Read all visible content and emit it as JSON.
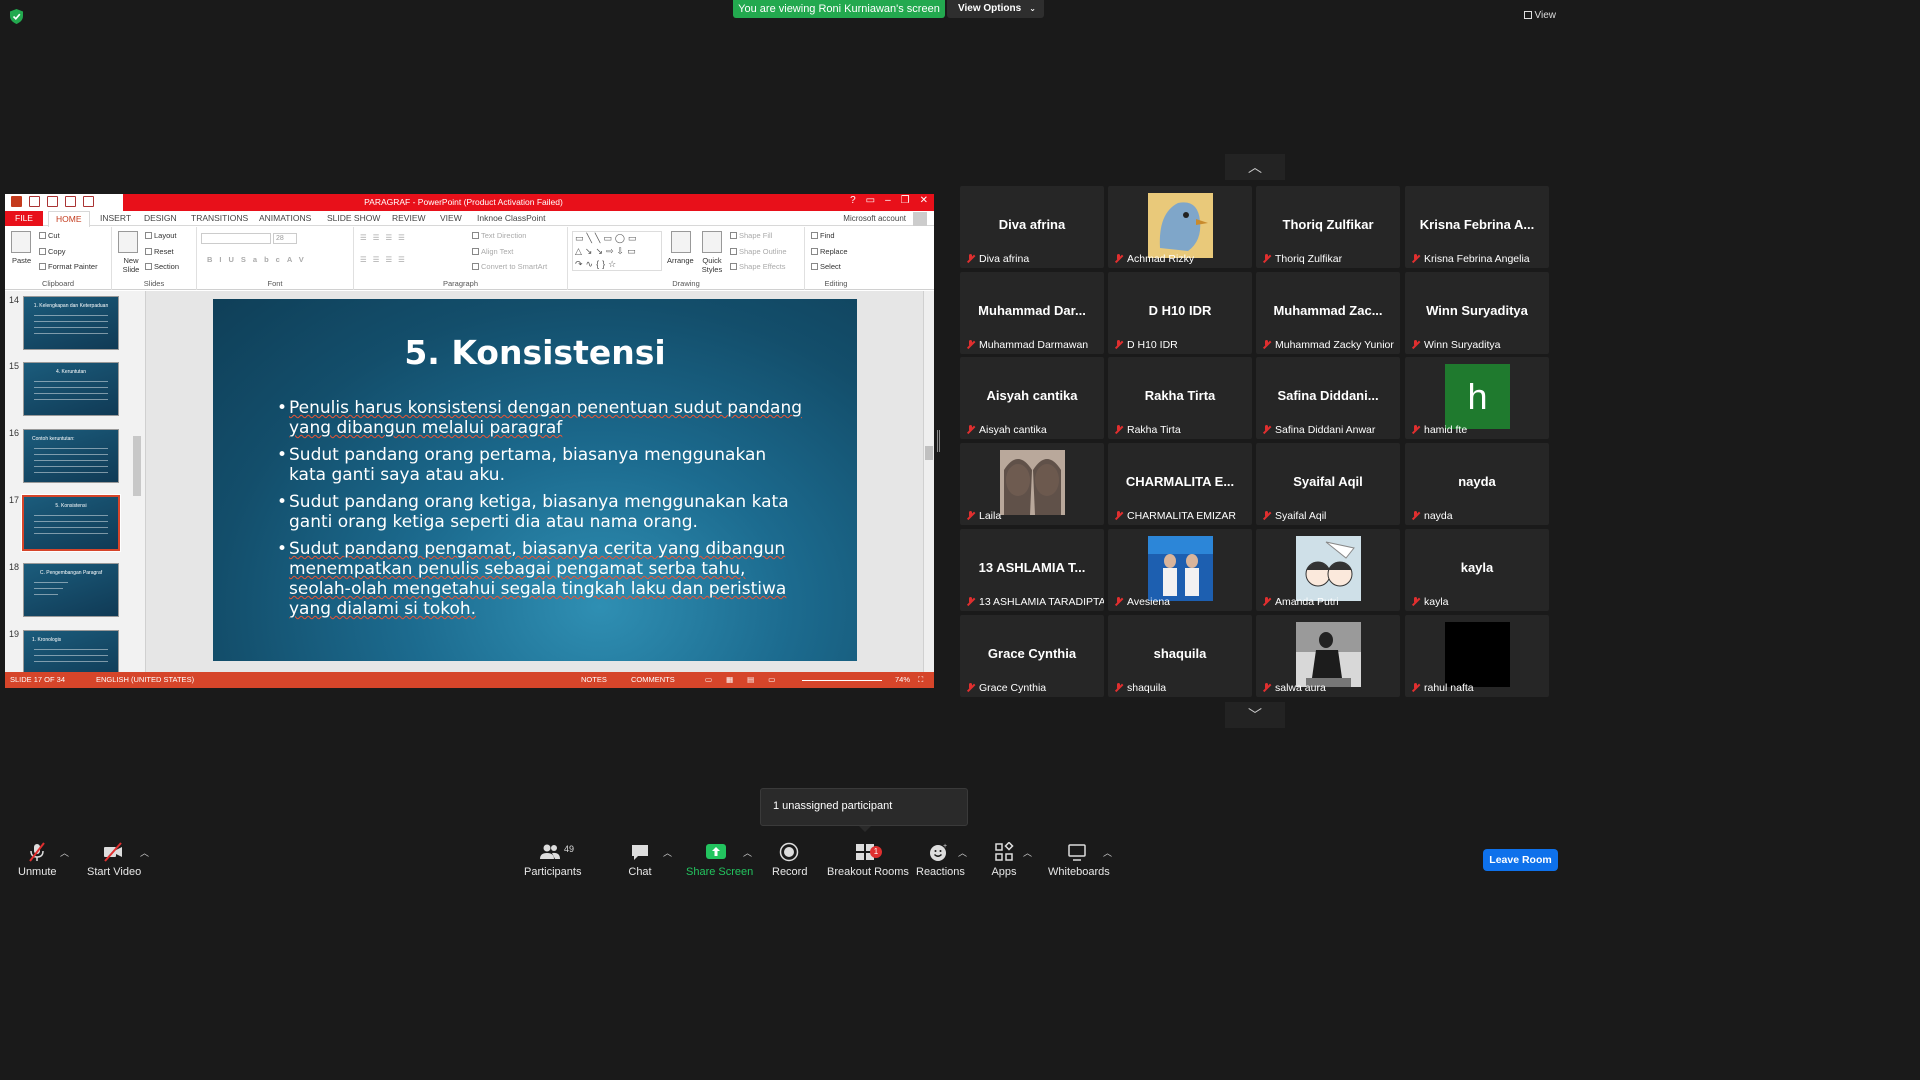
{
  "banner": {
    "viewing_text": "You are viewing Roni Kurniawan's screen",
    "view_options_label": "View Options",
    "view_label": "View"
  },
  "ppt": {
    "window_title": "PARAGRAF  -  PowerPoint (Product Activation Failed)",
    "tabs": [
      "FILE",
      "HOME",
      "INSERT",
      "DESIGN",
      "TRANSITIONS",
      "ANIMATIONS",
      "SLIDE SHOW",
      "REVIEW",
      "VIEW",
      "Inknoe ClassPoint"
    ],
    "account": "Microsoft account",
    "ribbon": {
      "clipboard": {
        "paste": "Paste",
        "cut": "Cut",
        "copy": "Copy",
        "format_painter": "Format Painter",
        "label": "Clipboard"
      },
      "slides": {
        "new_slide": "New Slide",
        "layout": "Layout",
        "reset": "Reset",
        "section": "Section",
        "label": "Slides"
      },
      "font": {
        "size": "28",
        "label": "Font"
      },
      "paragraph": {
        "text_direction": "Text Direction",
        "align_text": "Align Text",
        "convert": "Convert to SmartArt",
        "label": "Paragraph"
      },
      "drawing": {
        "arrange": "Arrange",
        "quick_styles": "Quick Styles",
        "shape_fill": "Shape Fill",
        "shape_outline": "Shape Outline",
        "shape_effects": "Shape Effects",
        "label": "Drawing"
      },
      "editing": {
        "find": "Find",
        "replace": "Replace",
        "select": "Select",
        "label": "Editing"
      }
    },
    "thumbnails": [
      {
        "num": "14",
        "title": "1. Kelengkapan dan Keterpaduan"
      },
      {
        "num": "15",
        "title": "4. Keruntutan"
      },
      {
        "num": "16",
        "title": "Contoh keruntutan:"
      },
      {
        "num": "17",
        "title": "5. Konsistensi"
      },
      {
        "num": "18",
        "title": "C. Pengembangan Paragraf"
      },
      {
        "num": "19",
        "title": "1. Kronologis"
      }
    ],
    "slide": {
      "title": "5. Konsistensi",
      "bullets": [
        "Penulis harus konsistensi dengan penentuan sudut pandang yang dibangun melalui paragraf",
        "Sudut pandang orang pertama, biasanya menggunakan kata ganti saya atau aku.",
        "Sudut pandang orang ketiga, biasanya menggunakan kata ganti orang ketiga seperti dia atau nama orang.",
        "Sudut pandang pengamat, biasanya cerita yang dibangun menempatkan penulis sebagai pengamat serba tahu, seolah-olah mengetahui segala tingkah laku dan peristiwa yang dialami si tokoh."
      ]
    },
    "status": {
      "slide_of": "SLIDE 17 OF 34",
      "language": "ENGLISH (UNITED STATES)",
      "notes": "NOTES",
      "comments": "COMMENTS",
      "zoom": "74%"
    }
  },
  "participants": [
    {
      "big": "Diva afrina",
      "label": "Diva afrina"
    },
    {
      "big": "",
      "label": "Achmad Rizky",
      "photo": "bird"
    },
    {
      "big": "Thoriq Zulfikar",
      "label": "Thoriq Zulfikar"
    },
    {
      "big": "Krisna  Febrina A...",
      "label": "Krisna Febrina Angelia"
    },
    {
      "big": "Muhammad  Dar...",
      "label": "Muhammad Darmawan"
    },
    {
      "big": "D H10 IDR",
      "label": "D H10 IDR"
    },
    {
      "big": "Muhammad  Zac...",
      "label": "Muhammad Zacky Yunior"
    },
    {
      "big": "Winn Suryaditya",
      "label": "Winn Suryaditya"
    },
    {
      "big": "Aisyah cantika",
      "label": "Aisyah cantika"
    },
    {
      "big": "Rakha Tirta",
      "label": "Rakha Tirta"
    },
    {
      "big": "Safina  Diddani...",
      "label": "Safina Diddani Anwar"
    },
    {
      "big": "",
      "label": "hamid fte",
      "initial": "h"
    },
    {
      "big": "",
      "label": "Laila",
      "photo": "girls"
    },
    {
      "big": "CHARMALITA  E...",
      "label": "CHARMALITA EMIZAR"
    },
    {
      "big": "Syaifal Aqil",
      "label": "Syaifal Aqil"
    },
    {
      "big": "nayda",
      "label": "nayda"
    },
    {
      "big": "13  ASHLAMIA  T...",
      "label": "13 ASHLAMIA TARADIPTA"
    },
    {
      "big": "",
      "label": "Avesiena",
      "photo": "stage"
    },
    {
      "big": "",
      "label": "Amanda Putri",
      "photo": "anime"
    },
    {
      "big": "kayla",
      "label": "kayla"
    },
    {
      "big": "Grace Cynthia",
      "label": "Grace Cynthia"
    },
    {
      "big": "shaquila",
      "label": "shaquila"
    },
    {
      "big": "",
      "label": "salwa aura",
      "photo": "street"
    },
    {
      "big": "",
      "label": "rahul nafta",
      "photo": "black"
    }
  ],
  "toast": "1 unassigned participant",
  "toolbar": {
    "unmute": "Unmute",
    "start_video": "Start Video",
    "participants": "Participants",
    "participants_count": "49",
    "chat": "Chat",
    "share_screen": "Share Screen",
    "record": "Record",
    "breakout_rooms": "Breakout Rooms",
    "breakout_badge": "1",
    "reactions": "Reactions",
    "apps": "Apps",
    "whiteboards": "Whiteboards",
    "leave_room": "Leave Room"
  },
  "colors": {
    "share_green": "#23a94f",
    "ppt_red": "#e8101a",
    "status_orange": "#d6452a",
    "leave_blue": "#0e71eb",
    "muted_red": "#e02f2f"
  }
}
